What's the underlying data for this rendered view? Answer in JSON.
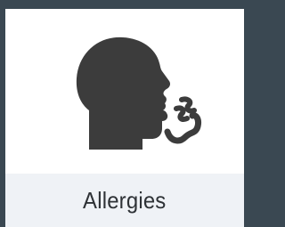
{
  "tile": {
    "label": "Allergies",
    "icon": "sneezing-face-icon",
    "colors": {
      "frame": "#3a4852",
      "card": "#ffffff",
      "label_bg": "#eff2f6",
      "icon": "#3c3c3c",
      "text": "#2e3236"
    }
  }
}
